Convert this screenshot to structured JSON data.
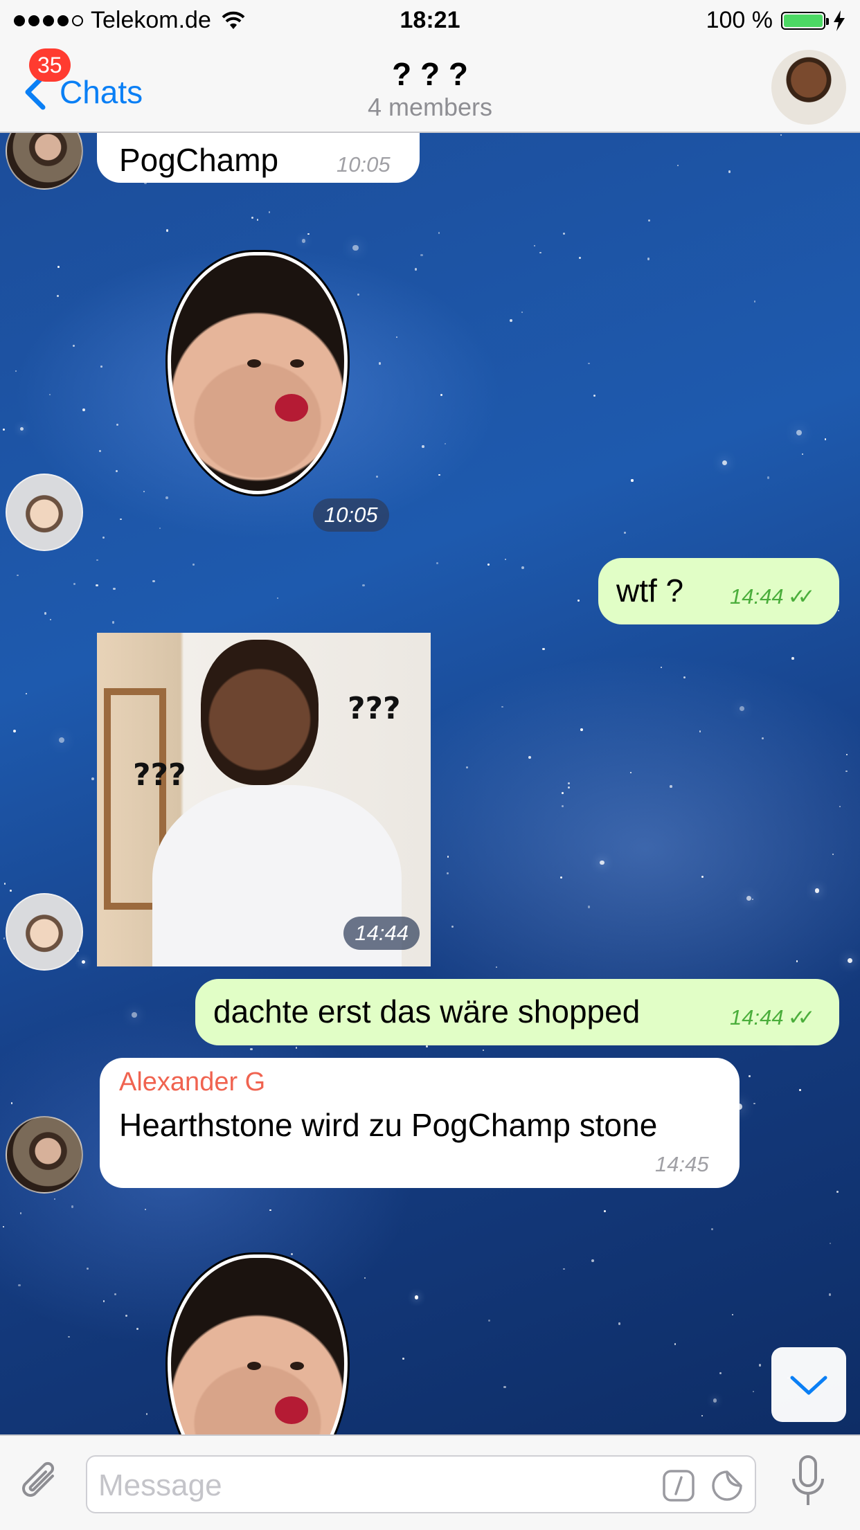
{
  "status_bar": {
    "carrier": "Telekom.de",
    "time": "18:21",
    "battery": "100 %"
  },
  "nav": {
    "back_label": "Chats",
    "back_badge": "35",
    "title": "? ? ?",
    "subtitle": "4 members"
  },
  "messages": [
    {
      "text": "PogChamp",
      "time": "10:05"
    },
    {
      "time": "10:05"
    },
    {
      "text": "wtf ?",
      "time": "14:44"
    },
    {
      "photo_text_1": "???",
      "photo_text_2": "???",
      "time": "14:44"
    },
    {
      "text": "dachte erst das wäre shopped",
      "time": "14:44"
    },
    {
      "sender": "Alexander G",
      "text": "Hearthstone wird zu PogChamp stone",
      "time": "14:45"
    }
  ],
  "input": {
    "placeholder": "Message"
  },
  "colors": {
    "accent": "#0a7ff5",
    "outgoing_bubble": "#e1fec6",
    "incoming_bubble": "#ffffff",
    "sender_name": "#f06350",
    "badge": "#ff3b30",
    "read_ticks": "#4bae3c"
  },
  "icons": {
    "back": "chevron-left-icon",
    "wifi": "wifi-icon",
    "battery": "battery-icon",
    "charging": "bolt-icon",
    "attach": "paperclip-icon",
    "commands": "slash-command-icon",
    "stickers": "sticker-icon",
    "microphone": "microphone-icon",
    "scroll_down": "chevron-down-icon",
    "read_receipt": "double-check-icon"
  }
}
